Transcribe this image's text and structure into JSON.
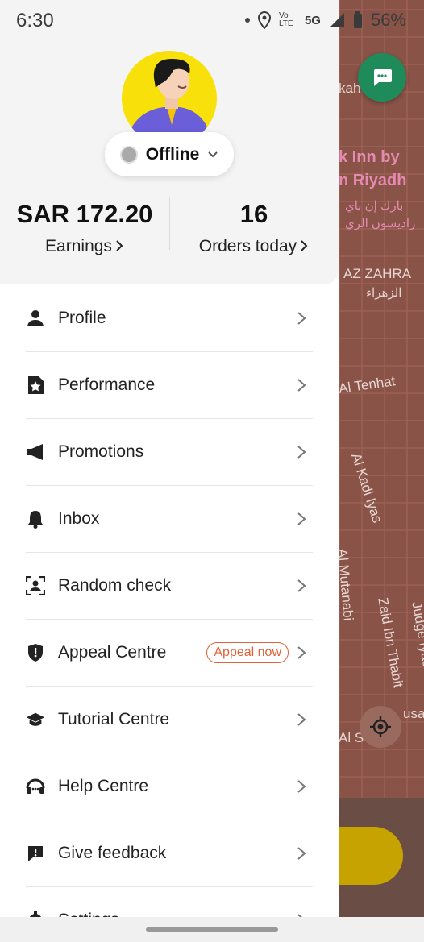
{
  "status_bar": {
    "time": "6:30",
    "network": "5G",
    "volte": "Vo LTE",
    "battery": "56%"
  },
  "profile": {
    "status": "Offline"
  },
  "stats": {
    "earnings_value": "SAR 172.20",
    "earnings_label": "Earnings",
    "orders_value": "16",
    "orders_label": "Orders today"
  },
  "menu": [
    {
      "label": "Profile",
      "icon": "person-icon"
    },
    {
      "label": "Performance",
      "icon": "star-document-icon"
    },
    {
      "label": "Promotions",
      "icon": "megaphone-icon"
    },
    {
      "label": "Inbox",
      "icon": "bell-icon"
    },
    {
      "label": "Random check",
      "icon": "face-scan-icon"
    },
    {
      "label": "Appeal Centre",
      "icon": "shield-icon",
      "badge": "Appeal now"
    },
    {
      "label": "Tutorial Centre",
      "icon": "graduation-cap-icon"
    },
    {
      "label": "Help Centre",
      "icon": "headset-icon"
    },
    {
      "label": "Give feedback",
      "icon": "feedback-icon"
    },
    {
      "label": "Settings",
      "icon": "gear-icon"
    }
  ],
  "map": {
    "labels": [
      "k Inn by",
      "n Riyadh",
      "بارك إن باي",
      "راديسون الري",
      "AZ ZAHRA",
      "الزهراء",
      "Al Tenhat",
      "Al Kadi Iyas",
      "Al Mutanabi",
      "Zaid Ibn Thabit",
      "Judge Iyas S",
      "Al S",
      "usab"
    ]
  },
  "colors": {
    "accent": "#e0623a",
    "avatar_bg": "#f8e10b",
    "map_bg": "#8a5348"
  }
}
